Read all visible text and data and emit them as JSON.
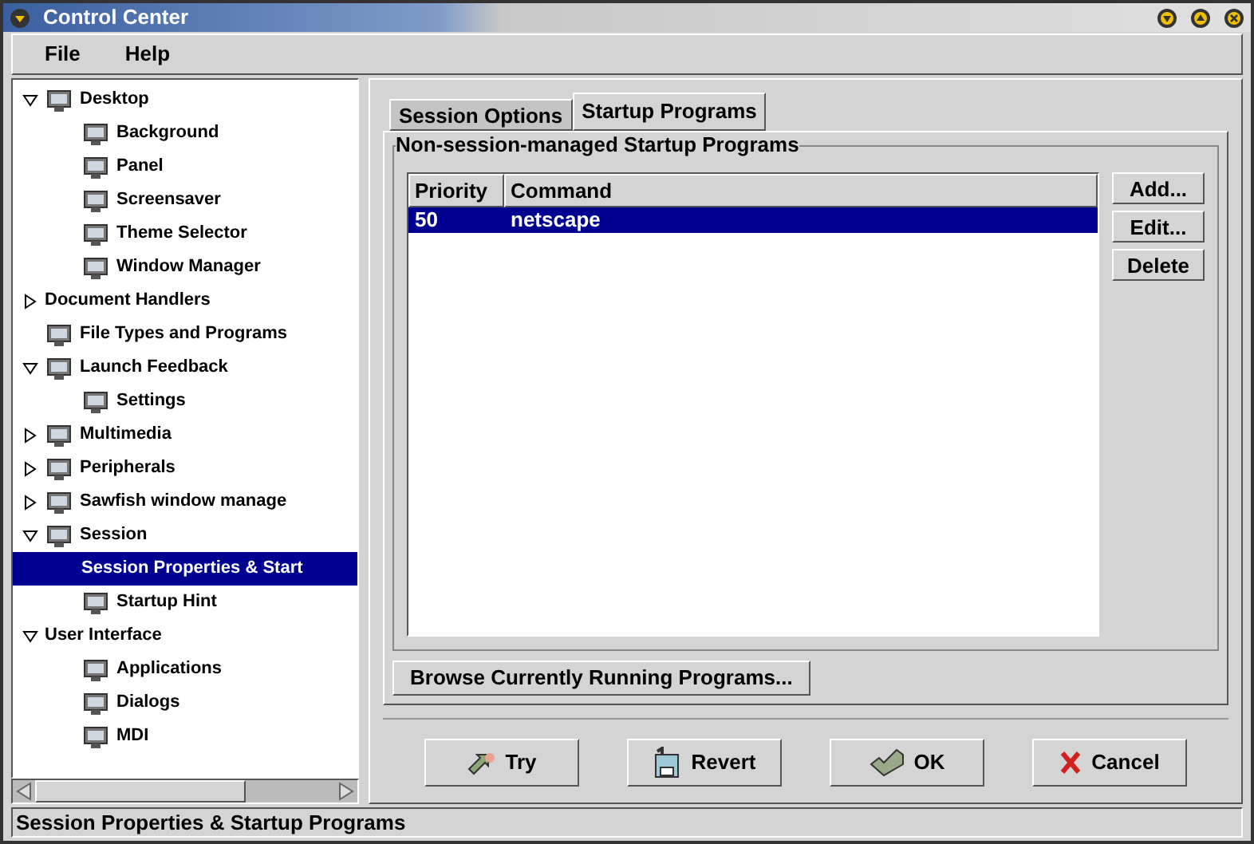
{
  "window": {
    "title": "Control Center"
  },
  "menu": [
    "File",
    "Help"
  ],
  "tree": [
    {
      "label": "Desktop",
      "icon": true,
      "expanded": true,
      "selected": false,
      "children": [
        {
          "label": "Background",
          "icon": true,
          "selected": false
        },
        {
          "label": "Panel",
          "icon": true,
          "selected": false
        },
        {
          "label": "Screensaver",
          "icon": true,
          "selected": false
        },
        {
          "label": "Theme Selector",
          "icon": true,
          "selected": false
        },
        {
          "label": "Window Manager",
          "icon": true,
          "selected": false
        }
      ]
    },
    {
      "label": "Document Handlers",
      "icon": false,
      "expanded": false,
      "selected": false
    },
    {
      "label": "File Types and Programs",
      "icon": true,
      "selected": false
    },
    {
      "label": "Launch Feedback",
      "icon": true,
      "expanded": true,
      "selected": false,
      "children": [
        {
          "label": "Settings",
          "icon": true,
          "selected": false
        }
      ]
    },
    {
      "label": "Multimedia",
      "icon": true,
      "expanded": false,
      "selected": false
    },
    {
      "label": "Peripherals",
      "icon": true,
      "expanded": false,
      "selected": false
    },
    {
      "label": "Sawfish window manage",
      "icon": true,
      "expanded": false,
      "selected": false
    },
    {
      "label": "Session",
      "icon": true,
      "expanded": true,
      "selected": false,
      "children": [
        {
          "label": "Session Properties & Start",
          "icon": false,
          "selected": true
        },
        {
          "label": "Startup Hint",
          "icon": true,
          "selected": false
        }
      ]
    },
    {
      "label": "User Interface",
      "icon": false,
      "expanded": true,
      "selected": false,
      "children": [
        {
          "label": "Applications",
          "icon": true,
          "selected": false
        },
        {
          "label": "Dialogs",
          "icon": true,
          "selected": false
        },
        {
          "label": "MDI",
          "icon": true,
          "selected": false
        }
      ]
    }
  ],
  "tabs": [
    {
      "label": "Session Options",
      "selected": false
    },
    {
      "label": "Startup Programs",
      "selected": true
    }
  ],
  "group": {
    "title": "Non-session-managed Startup Programs"
  },
  "table": {
    "columns": [
      "Priority",
      "Command"
    ],
    "rows": [
      {
        "cells": [
          "50",
          "netscape"
        ],
        "selected": true
      }
    ]
  },
  "side_buttons": [
    "Add...",
    "Edit...",
    "Delete"
  ],
  "browse_button": "Browse Currently Running Programs...",
  "buttons": [
    {
      "label": "Try",
      "kind": "try"
    },
    {
      "label": "Revert",
      "kind": "revert"
    },
    {
      "label": "OK",
      "kind": "ok"
    },
    {
      "label": "Cancel",
      "kind": "cancel"
    }
  ],
  "status_bar": "Session Properties & Startup Programs"
}
